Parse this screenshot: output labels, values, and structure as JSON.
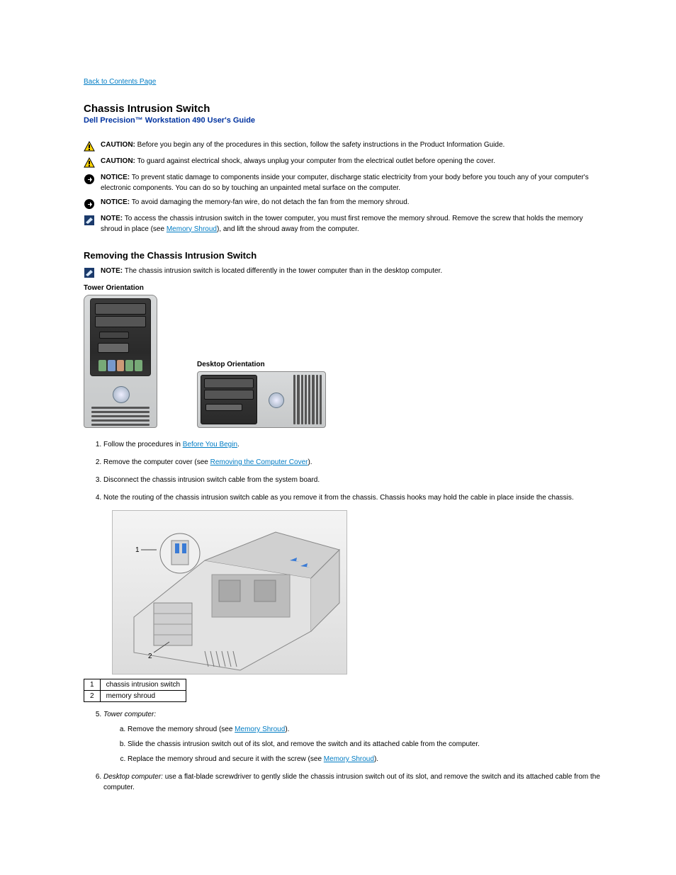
{
  "back_link": "Back to Contents Page",
  "page_title": "Chassis Intrusion Switch",
  "subtitle": "Dell Precision™ Workstation 490 User's Guide",
  "cautions": [
    {
      "type": "caution",
      "label": "CAUTION:",
      "text": "Before you begin any of the procedures in this section, follow the safety instructions in the Product Information Guide."
    },
    {
      "type": "caution",
      "label": "CAUTION:",
      "text": "To guard against electrical shock, always unplug your computer from the electrical outlet before opening the cover."
    },
    {
      "type": "notice",
      "label": "NOTICE:",
      "text": "To prevent static damage to components inside your computer, discharge static electricity from your body before you touch any of your computer's electronic components. You can do so by touching an unpainted metal surface on the computer."
    },
    {
      "type": "notice",
      "label": "NOTICE:",
      "text": "To avoid damaging the memory-fan wire, do not detach the fan from the memory shroud."
    },
    {
      "type": "note",
      "label": "NOTE:",
      "text": "To access the chassis intrusion switch in the tower computer, you must first remove the memory shroud. Remove the screw that holds the memory shroud in place (see ",
      "link_text": "Memory Shroud",
      "text_after": "), and lift the shroud away from the computer."
    }
  ],
  "section_heading": "Removing the Chassis Intrusion Switch",
  "orientation_note_label": "NOTE:",
  "orientation_note_text": "The chassis intrusion switch is located differently in the tower computer than in the desktop computer.",
  "tower_caption": "Tower Orientation",
  "desktop_caption": "Desktop Orientation",
  "steps": [
    {
      "n": 1,
      "text_before": "Follow the procedures in ",
      "link": "Before You Begin",
      "text_after": "."
    },
    {
      "n": 2,
      "text_before": "Remove the computer cover (see ",
      "link": "Removing the Computer Cover",
      "text_after": ")."
    },
    {
      "n": 3,
      "text": "Disconnect the chassis intrusion switch cable from the system board."
    },
    {
      "n": 4,
      "text": "Note the routing of the chassis intrusion switch cable as you remove it from the chassis. Chassis hooks may hold the cable in place inside the chassis."
    }
  ],
  "parts": [
    {
      "n": "1",
      "label": "chassis intrusion switch"
    },
    {
      "n": "2",
      "label": "memory shroud"
    }
  ],
  "tower_substeps": [
    {
      "n": "a",
      "text_before": "Remove the memory shroud (see ",
      "link": "Memory Shroud",
      "text_after": ")."
    },
    {
      "n": "b",
      "text": "Slide the chassis intrusion switch out of its slot, and remove the switch and its attached cable from the computer."
    },
    {
      "n": "c",
      "text_before": "Replace the memory shroud and secure it with the screw (see ",
      "link": "Memory Shroud",
      "text_after": ")."
    }
  ],
  "step5_prefix": "Tower computer:",
  "step6_prefix": "Desktop computer:",
  "step6_text": "use a flat-blade screwdriver to gently slide the chassis intrusion switch out of its slot, and remove the switch and its attached cable from the computer."
}
